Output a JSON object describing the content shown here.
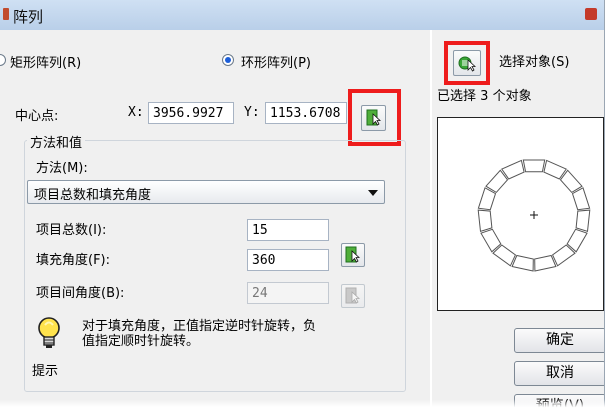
{
  "window": {
    "title": "阵列"
  },
  "mode": {
    "rect_label": "矩形阵列(R)",
    "polar_label": "环形阵列(P)",
    "selected": "polar"
  },
  "select": {
    "label": "选择对象(S)",
    "selected_prefix": "已选择",
    "selected_count": "3",
    "selected_suffix": "个对象"
  },
  "center": {
    "label": "中心点:",
    "x_label": "X:",
    "x_value": "3956.9927",
    "y_label": "Y:",
    "y_value": "1153.6708"
  },
  "method": {
    "group_title": "方法和值",
    "method_label": "方法(M):",
    "method_value": "项目总数和填充角度"
  },
  "fields": {
    "total_label": "项目总数(I):",
    "total_value": "15",
    "fill_label": "填充角度(F):",
    "fill_value": "360",
    "between_label": "项目间角度(B):",
    "between_value": "24"
  },
  "tip": {
    "text_line1": "对于填充角度，正值指定逆时针旋转，负",
    "text_line2": "值指定顺时针旋转。",
    "label": "提示"
  },
  "buttons": {
    "ok": "确定",
    "cancel": "取消",
    "preview": "预览(V)"
  },
  "colors": {
    "highlight": "#ee1c1c",
    "radio_selected": "#1c5ed8"
  }
}
